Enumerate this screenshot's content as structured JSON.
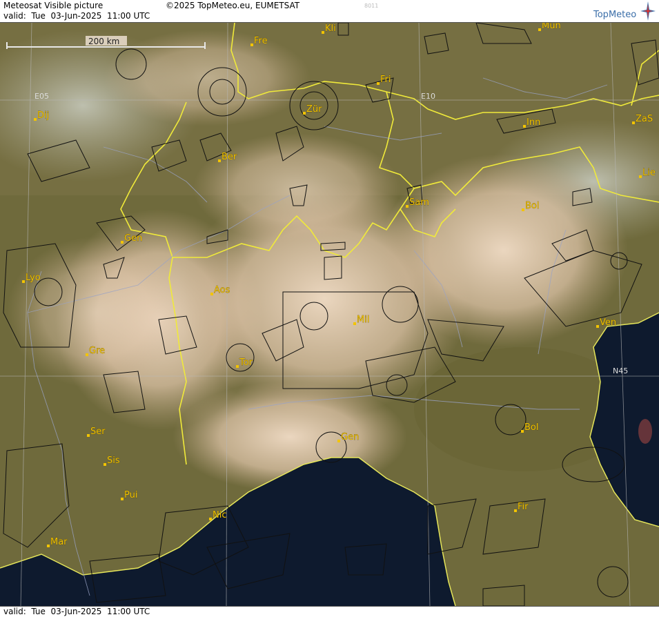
{
  "header": {
    "title": "Meteosat Visible picture",
    "copyright": "©2025 TopMeteo.eu, EUMETSAT",
    "code": "8011",
    "valid": "valid:  Tue  03-Jun-2025  11:00 UTC",
    "logo": "TopMeteo"
  },
  "footer": {
    "valid": "valid:  Tue  03-Jun-2025  11:00 UTC"
  },
  "map": {
    "scale_label": "200 km",
    "grid_labels": {
      "e05": "E05",
      "e10": "E10",
      "n45": "N45"
    },
    "cities": [
      {
        "id": "kli",
        "name": "Kli"
      },
      {
        "id": "mun",
        "name": "Mun"
      },
      {
        "id": "fre",
        "name": "Fre"
      },
      {
        "id": "fri",
        "name": "Fri"
      },
      {
        "id": "dij",
        "name": "Dij"
      },
      {
        "id": "zur",
        "name": "Zür"
      },
      {
        "id": "inn",
        "name": "Inn"
      },
      {
        "id": "zas",
        "name": "ZaS"
      },
      {
        "id": "ber",
        "name": "Ber"
      },
      {
        "id": "lie",
        "name": "Lie"
      },
      {
        "id": "sam",
        "name": "Sam"
      },
      {
        "id": "bol-n",
        "name": "Bol"
      },
      {
        "id": "gen-n",
        "name": "Gen"
      },
      {
        "id": "lyo",
        "name": "Lyo"
      },
      {
        "id": "aos",
        "name": "Aos"
      },
      {
        "id": "mil",
        "name": "Mil"
      },
      {
        "id": "ven",
        "name": "Ven"
      },
      {
        "id": "gre",
        "name": "Gre"
      },
      {
        "id": "tor",
        "name": "Tor"
      },
      {
        "id": "ser",
        "name": "Ser"
      },
      {
        "id": "gen-s",
        "name": "Gen"
      },
      {
        "id": "bol-s",
        "name": "Bol"
      },
      {
        "id": "sis",
        "name": "Sis"
      },
      {
        "id": "pui",
        "name": "Pui"
      },
      {
        "id": "nic",
        "name": "Nic"
      },
      {
        "id": "fir",
        "name": "Fir"
      },
      {
        "id": "mar",
        "name": "Mar"
      }
    ]
  }
}
